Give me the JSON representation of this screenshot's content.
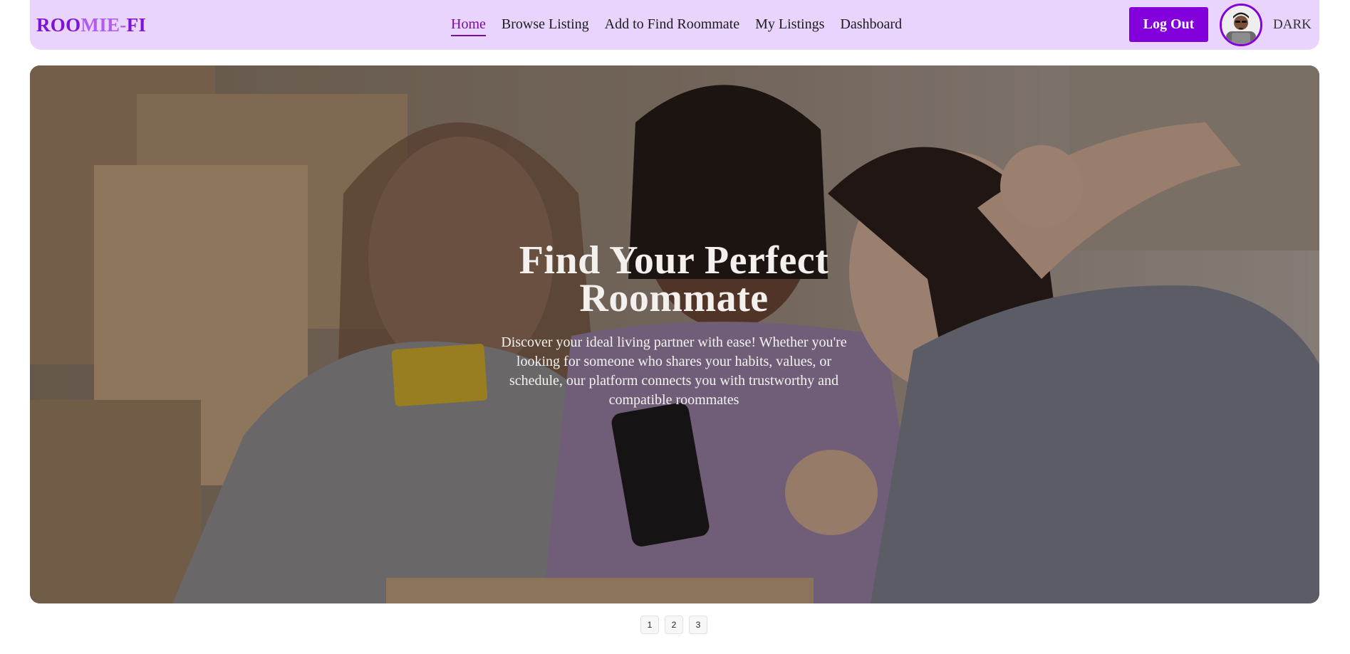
{
  "brand": {
    "logo_part1": "ROO",
    "logo_part2": "MIE-",
    "logo_part3": "FI"
  },
  "nav": {
    "items": [
      {
        "label": "Home",
        "active": true
      },
      {
        "label": "Browse Listing",
        "active": false
      },
      {
        "label": "Add to Find Roommate",
        "active": false
      },
      {
        "label": "My Listings",
        "active": false
      },
      {
        "label": "Dashboard",
        "active": false
      }
    ],
    "logout_label": "Log Out",
    "theme_label": "DARK"
  },
  "hero": {
    "title": "Find Your Perfect Roommate",
    "description": "Discover your ideal living partner with ease! Whether you're looking for someone who shares your habits, values, or schedule, our platform connects you with trustworthy and compatible roommates"
  },
  "pagination": {
    "pages": [
      "1",
      "2",
      "3"
    ]
  },
  "colors": {
    "nav_bg": "#e9d4fd",
    "brand_purple": "#8300dd",
    "active_link": "#7b0c9e"
  }
}
